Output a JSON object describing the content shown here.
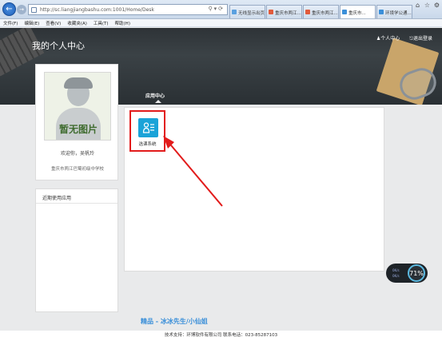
{
  "browser": {
    "url": "http://sc.liangjiangbashu.com:1001/Home/Desk",
    "tabs": [
      {
        "label": "无线显示出页",
        "active": false,
        "color": "#5aa0e0"
      },
      {
        "label": "重庆市两江...",
        "active": false,
        "color": "#e15a3b"
      },
      {
        "label": "重庆市两江...",
        "active": false,
        "color": "#e15a3b"
      },
      {
        "label": "重庆市...",
        "active": true,
        "color": "#3a8fd9"
      },
      {
        "label": "环境学公通...",
        "active": false,
        "color": "#3a8fd9"
      }
    ],
    "menu": [
      "文件(F)",
      "编辑(E)",
      "查看(V)",
      "收藏夹(A)",
      "工具(T)",
      "帮助(H)"
    ]
  },
  "header": {
    "title": "我的个人中心",
    "personal_center": "个人中心",
    "logout": "退出登录",
    "nav_tab": "应用中心"
  },
  "profile": {
    "placeholder_text": "暂无图片",
    "welcome": "欢迎你，吴帆玲",
    "school": "重庆市两江巴蜀初级中学校"
  },
  "recent": {
    "title": "近期使用应用"
  },
  "apps": [
    {
      "label": "选课系统",
      "icon": "course-select-icon",
      "highlighted": true
    }
  ],
  "widget": {
    "up": "0K/s",
    "down": "0K/s",
    "percent": "71%"
  },
  "footer": {
    "link": "精品 - 冰冰先生/小仙姐",
    "copyright": "技术支持：环博软件有限公司  联系电话：023-85287103"
  },
  "colors": {
    "highlight": "#e21b1b",
    "app_icon": "#1aa3d8",
    "banner": "#2e3337"
  }
}
